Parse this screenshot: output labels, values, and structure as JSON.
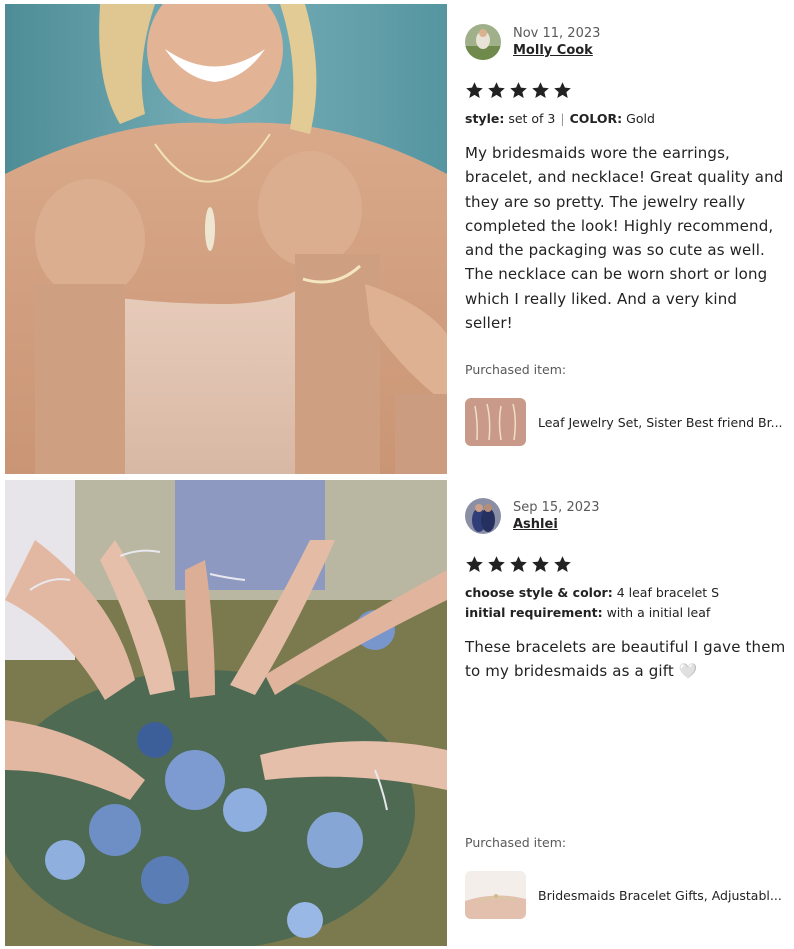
{
  "reviews": [
    {
      "date": "Nov 11, 2023",
      "reviewer": "Molly Cook",
      "rating": 5,
      "variations": [
        {
          "label": "style:",
          "value": "set of 3"
        },
        {
          "label": "COLOR:",
          "value": "Gold"
        }
      ],
      "text": "My bridesmaids wore the earrings, bracelet, and necklace! Great quality and they are so pretty. The jewelry really completed the look! Highly recommend, and the packaging was so cute as well. The necklace can be worn short or long which I really liked. And a very kind seller!",
      "purchased_label": "Purchased item:",
      "item_title": "Leaf Jewelry Set, Sister Best friend Br..."
    },
    {
      "date": "Sep 15, 2023",
      "reviewer": "Ashlei",
      "rating": 5,
      "variations": [
        {
          "label": "choose style & color:",
          "value": "4 leaf bracelet S"
        },
        {
          "label": "initial requirement:",
          "value": "with a initial leaf"
        }
      ],
      "text": "These bracelets are beautiful I gave them to my bridesmaids as a gift 🤍",
      "purchased_label": "Purchased item:",
      "item_title": "Bridesmaids Bracelet Gifts, Adjustabl..."
    }
  ],
  "icons": {
    "star": "star-icon",
    "star_color": "#222222"
  }
}
